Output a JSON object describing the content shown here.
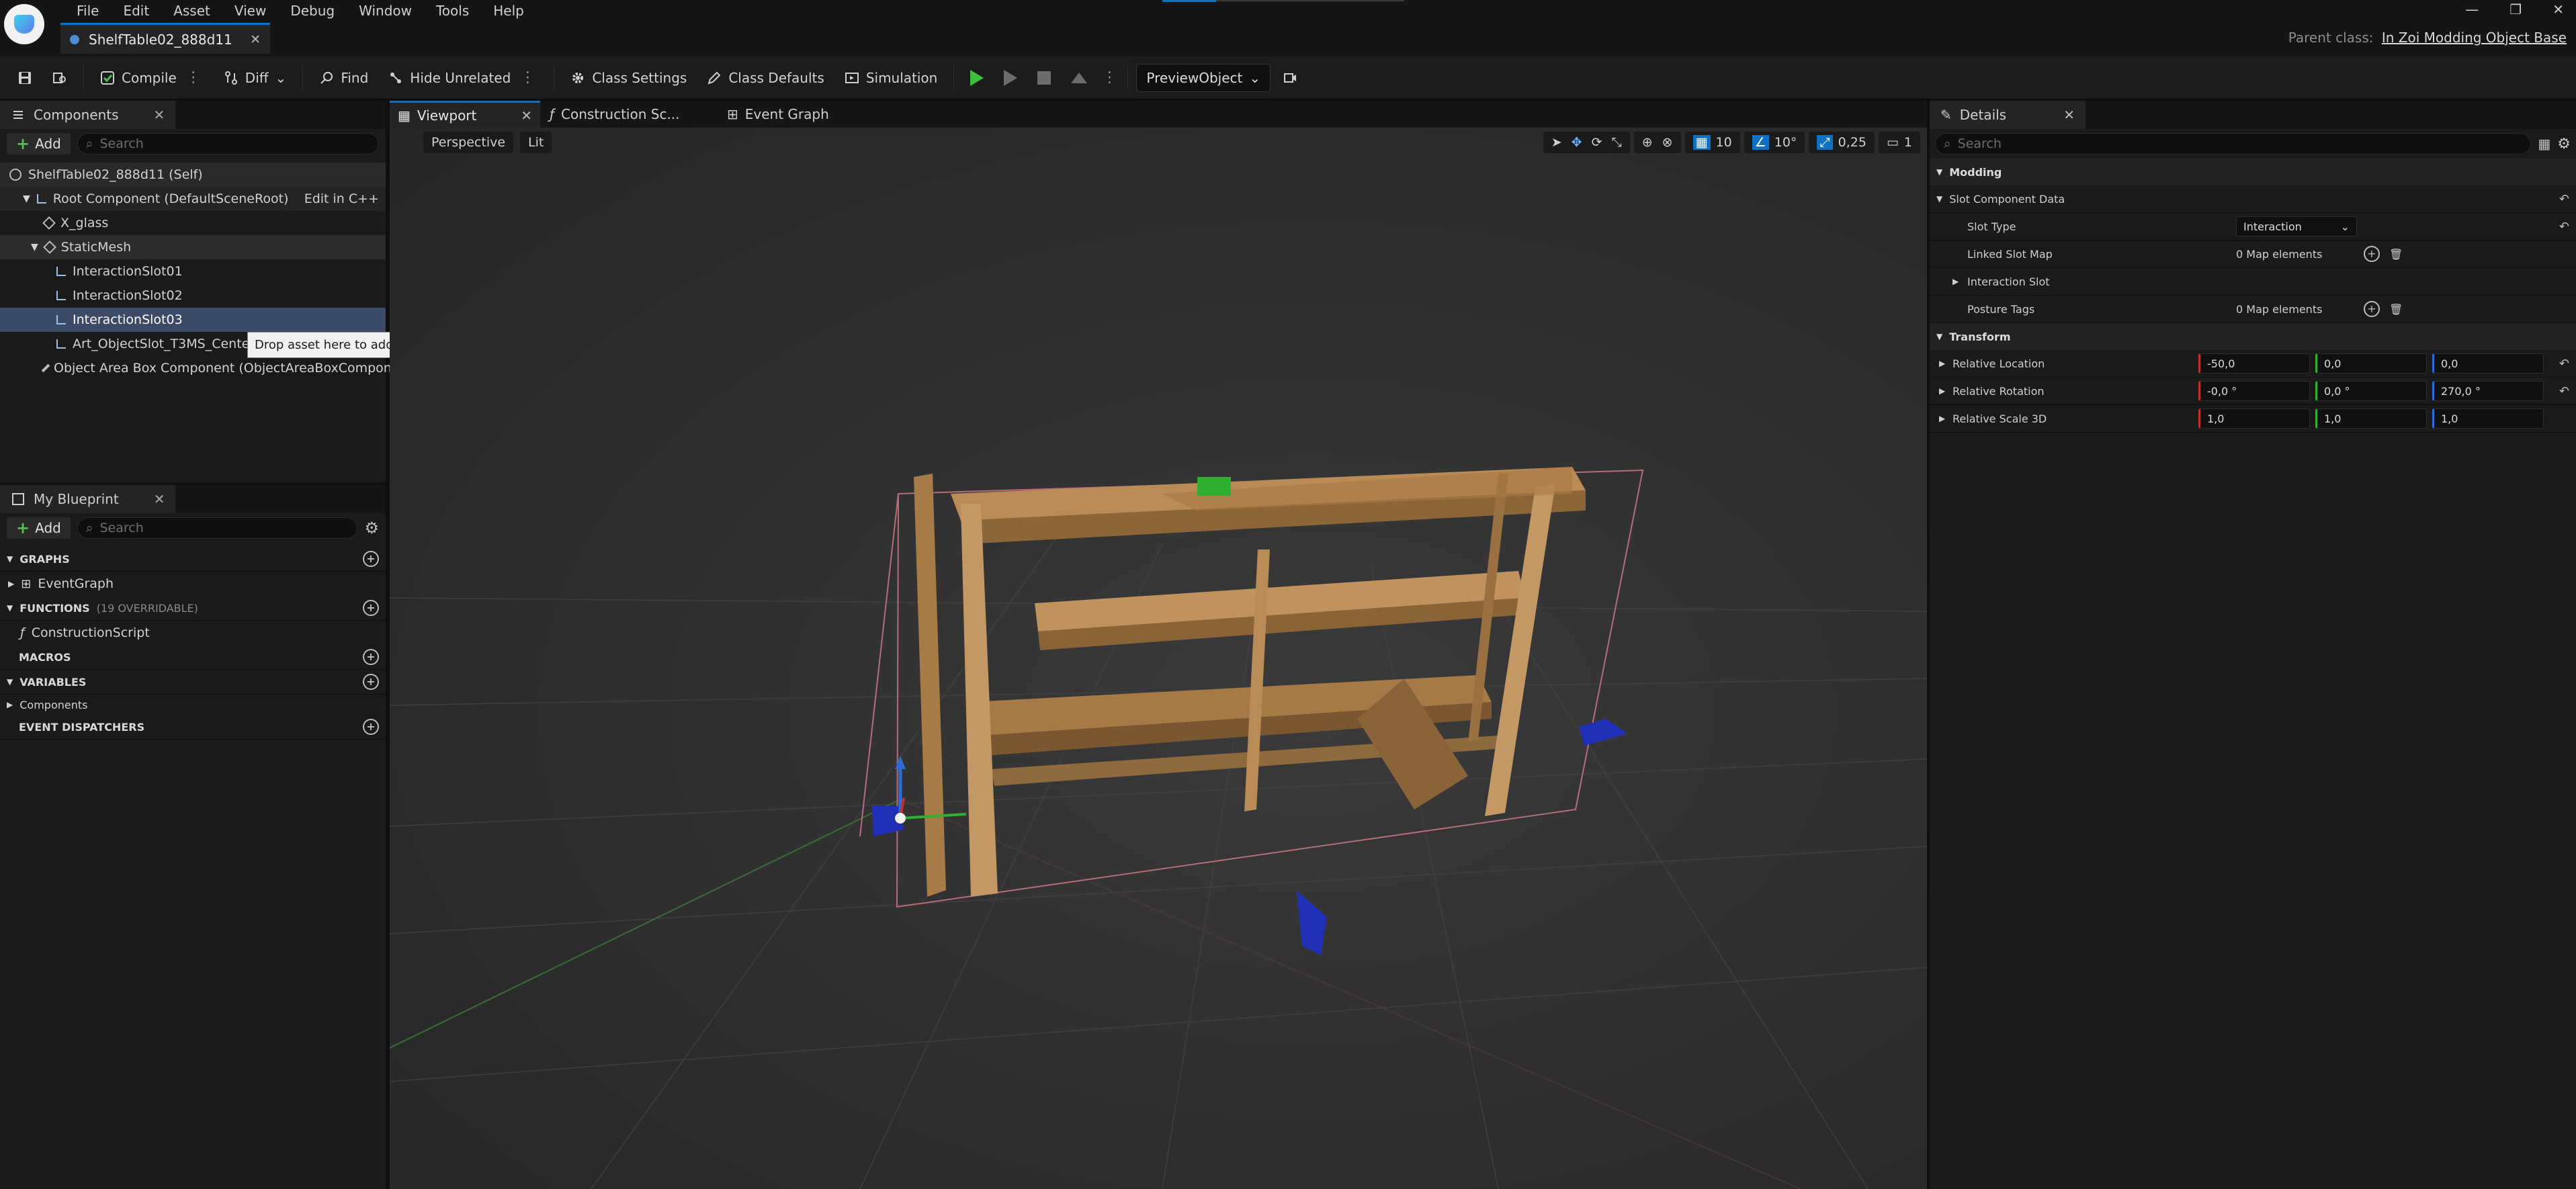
{
  "menu": [
    "File",
    "Edit",
    "Asset",
    "View",
    "Debug",
    "Window",
    "Tools",
    "Help"
  ],
  "document_tab": "ShelfTable02_888d11",
  "parent_class": {
    "label": "Parent class:",
    "value": "In Zoi Modding Object Base"
  },
  "toolbar": {
    "compile": "Compile",
    "diff": "Diff",
    "find": "Find",
    "hide_unrelated": "Hide Unrelated",
    "class_settings": "Class Settings",
    "class_defaults": "Class Defaults",
    "simulation": "Simulation",
    "preview_object": "PreviewObject"
  },
  "components": {
    "tab": "Components",
    "add": "Add",
    "search_placeholder": "Search",
    "tree": [
      {
        "label": "ShelfTable02_888d11 (Self)"
      },
      {
        "label": "Root Component (DefaultSceneRoot)",
        "extra": "Edit in C++"
      },
      {
        "label": "X_glass"
      },
      {
        "label": "StaticMesh"
      },
      {
        "label": "InteractionSlot01"
      },
      {
        "label": "InteractionSlot02"
      },
      {
        "label": "InteractionSlot03"
      },
      {
        "label": "Art_ObjectSlot_T3MS_Center"
      },
      {
        "label": "Object Area Box Component (ObjectAreaBoxCompon"
      }
    ],
    "tooltip": "Drop asset here to add a component."
  },
  "my_blueprint": {
    "tab": "My Blueprint",
    "add": "Add",
    "search_placeholder": "Search",
    "graphs": "GRAPHS",
    "event_graph": "EventGraph",
    "functions": "FUNCTIONS",
    "functions_count": "(19 OVERRIDABLE)",
    "construction_script": "ConstructionScript",
    "macros": "MACROS",
    "variables": "VARIABLES",
    "components": "Components",
    "event_dispatchers": "EVENT DISPATCHERS"
  },
  "viewport_tabs": [
    "Viewport",
    "Construction Sc...",
    "Event Graph"
  ],
  "viewport": {
    "perspective": "Perspective",
    "lit": "Lit",
    "grid_snap": "10",
    "rot_snap": "10°",
    "scale_snap": "0,25",
    "camera_speed": "1"
  },
  "details": {
    "tab": "Details",
    "search_placeholder": "Search",
    "modding": "Modding",
    "slot_component_data": "Slot Component Data",
    "slot_type_label": "Slot Type",
    "slot_type_value": "Interaction",
    "linked_slot_map_label": "Linked Slot Map",
    "linked_slot_map_value": "0 Map elements",
    "interaction_slot_label": "Interaction Slot",
    "posture_tags_label": "Posture Tags",
    "posture_tags_value": "0 Map elements",
    "transform": "Transform",
    "relative_location_label": "Relative Location",
    "relative_location": [
      "-50,0",
      "0,0",
      "0,0"
    ],
    "relative_rotation_label": "Relative Rotation",
    "relative_rotation": [
      "-0,0 °",
      "0,0 °",
      "270,0 °"
    ],
    "relative_scale_label": "Relative Scale 3D",
    "relative_scale": [
      "1,0",
      "1,0",
      "1,0"
    ]
  }
}
